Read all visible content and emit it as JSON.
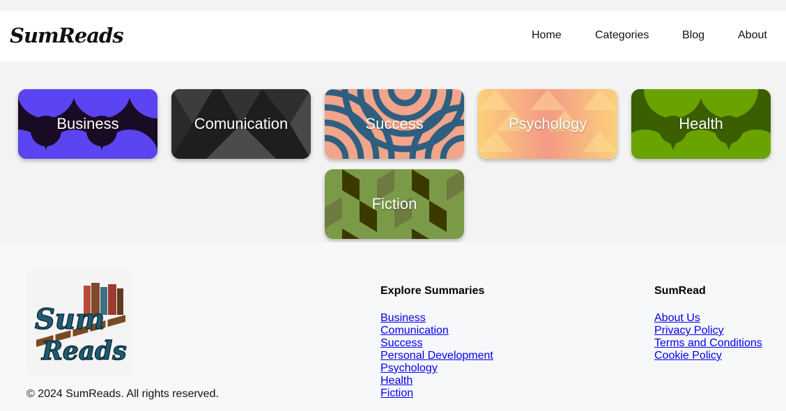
{
  "header": {
    "logo_text": "SumReads",
    "nav": [
      "Home",
      "Categories",
      "Blog",
      "About"
    ]
  },
  "categories": [
    {
      "label": "Business",
      "colors": [
        "#5b45f2",
        "#1a0b24"
      ]
    },
    {
      "label": "Comunication",
      "colors": [
        "#2b2b2b",
        "#4a4a4a"
      ]
    },
    {
      "label": "Success",
      "colors": [
        "#f2a58a",
        "#2f5f80"
      ]
    },
    {
      "label": "Psychology",
      "colors": [
        "#fbd07a",
        "#f49a86"
      ]
    },
    {
      "label": "Health",
      "colors": [
        "#6aa300",
        "#3b5e00"
      ]
    },
    {
      "label": "Fiction",
      "colors": [
        "#7a9a48",
        "#3a3a00"
      ]
    }
  ],
  "footer": {
    "logo_text_line1": "Sum",
    "logo_text_line2": "Reads",
    "copyright": "© 2024 SumReads. All rights reserved.",
    "explore": {
      "title": "Explore Summaries",
      "links": [
        "Business",
        "Comunication",
        "Success",
        "Personal Development",
        "Psychology",
        "Health",
        "Fiction"
      ]
    },
    "sumread": {
      "title": "SumRead",
      "links": [
        "About Us",
        "Privacy Policy",
        "Terms and Conditions",
        "Cookie Policy"
      ]
    }
  }
}
